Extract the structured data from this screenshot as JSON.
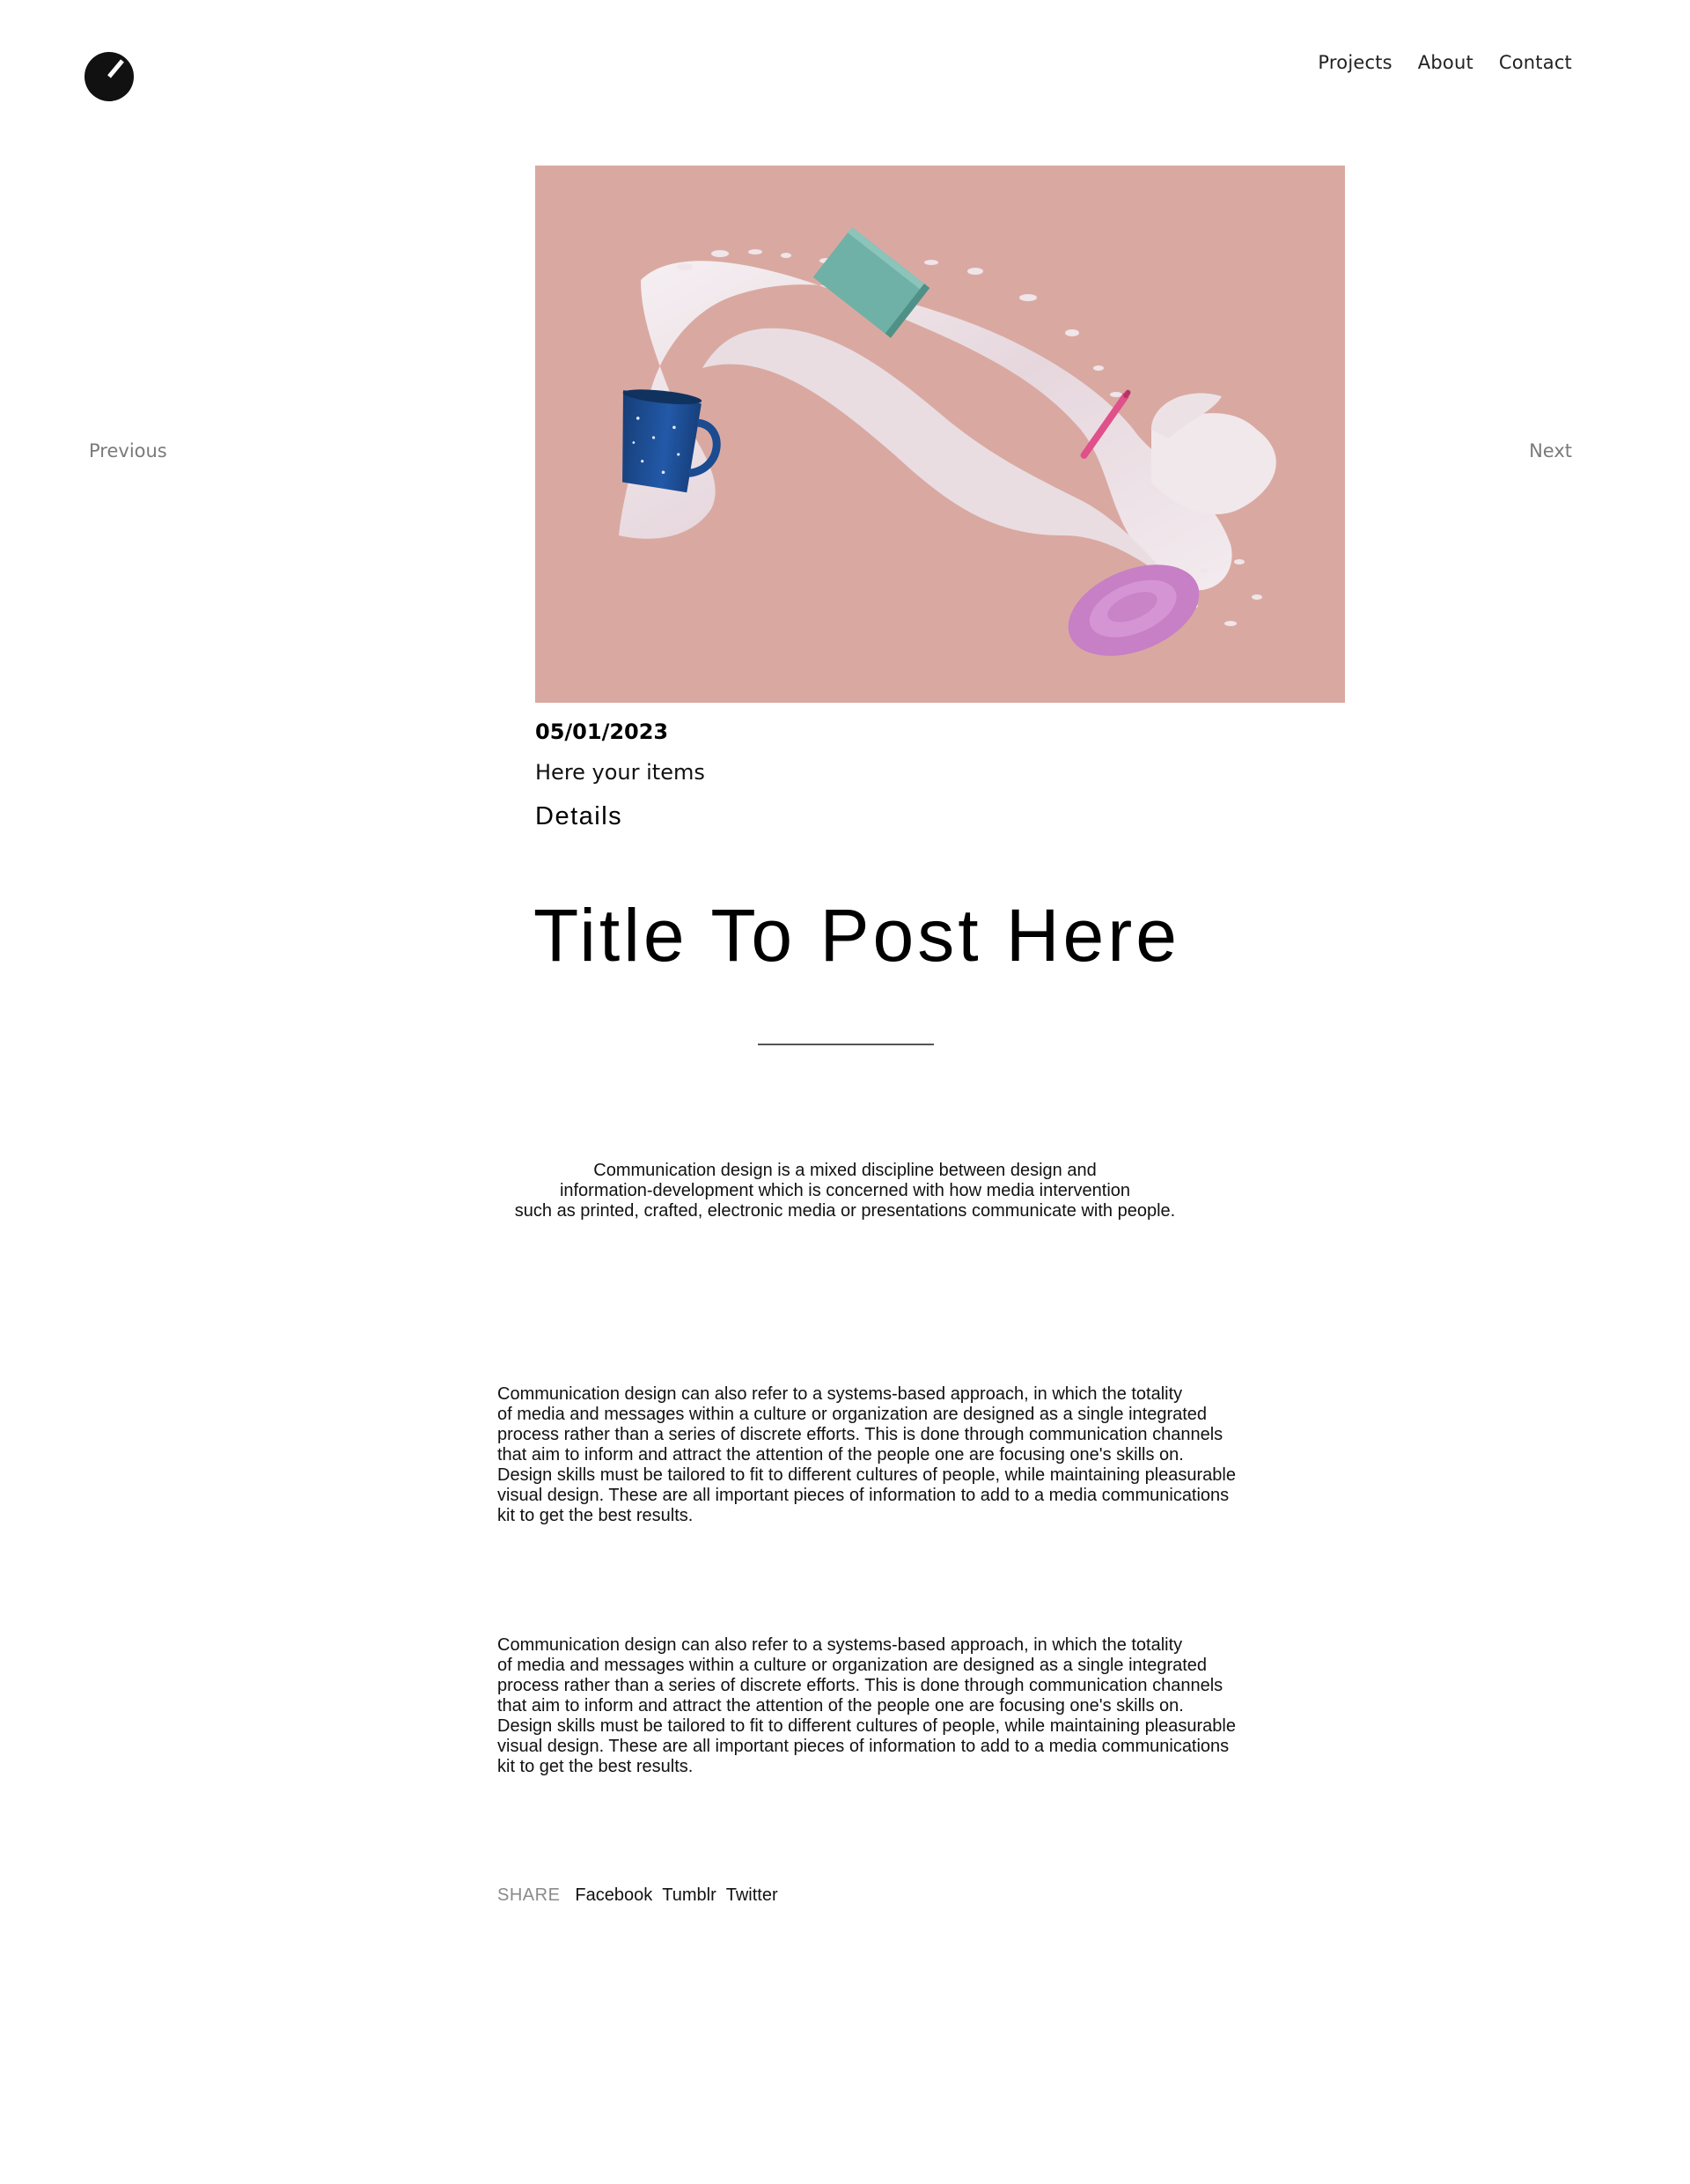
{
  "header": {
    "nav": [
      {
        "label": "Projects"
      },
      {
        "label": "About"
      },
      {
        "label": "Contact"
      }
    ]
  },
  "pagination": {
    "previous_label": "Previous",
    "next_label": "Next"
  },
  "post": {
    "date": "05/01/2023",
    "items_text": "Here your items",
    "details_label": "Details",
    "title": "Title To Post Here",
    "intro_lines": [
      "Communication design is a mixed discipline between design and",
      "information-development which is concerned with how media intervention",
      "such as printed, crafted, electronic media or presentations communicate with people."
    ],
    "paragraphs": [
      {
        "lines": [
          "Communication design can also refer to a systems-based approach, in which the totality",
          "of media and messages within a culture or organization are designed as a single integrated",
          "process rather than a series of discrete efforts. This is done through communication channels",
          "that aim to inform and attract the attention of the people one are focusing one's skills on.",
          "Design skills must be tailored to fit to different cultures of people, while maintaining pleasurable",
          "visual design. These are all important pieces of information to add to a media communications",
          "kit to get the best results."
        ]
      },
      {
        "lines": [
          "Communication design can also refer to a systems-based approach, in which the totality",
          "of media and messages within a culture or organization are designed as a single integrated",
          "process rather than a series of discrete efforts. This is done through communication channels",
          "that aim to inform and attract the attention of the people one are focusing one's skills on.",
          "Design skills must be tailored to fit to different cultures of people, while maintaining pleasurable",
          "visual design. These are all important pieces of information to add to a media communications",
          "kit to get the best results."
        ]
      }
    ]
  },
  "share": {
    "label": "SHARE",
    "links": [
      {
        "label": "Facebook"
      },
      {
        "label": "Tumblr"
      },
      {
        "label": "Twitter"
      }
    ]
  },
  "colors": {
    "hero_background": "#d9a9a1",
    "milk": "#ece2e6",
    "mug": "#1d4f94",
    "book": "#6fb1a7",
    "pen": "#e0508a",
    "saucer": "#c77fc6"
  }
}
